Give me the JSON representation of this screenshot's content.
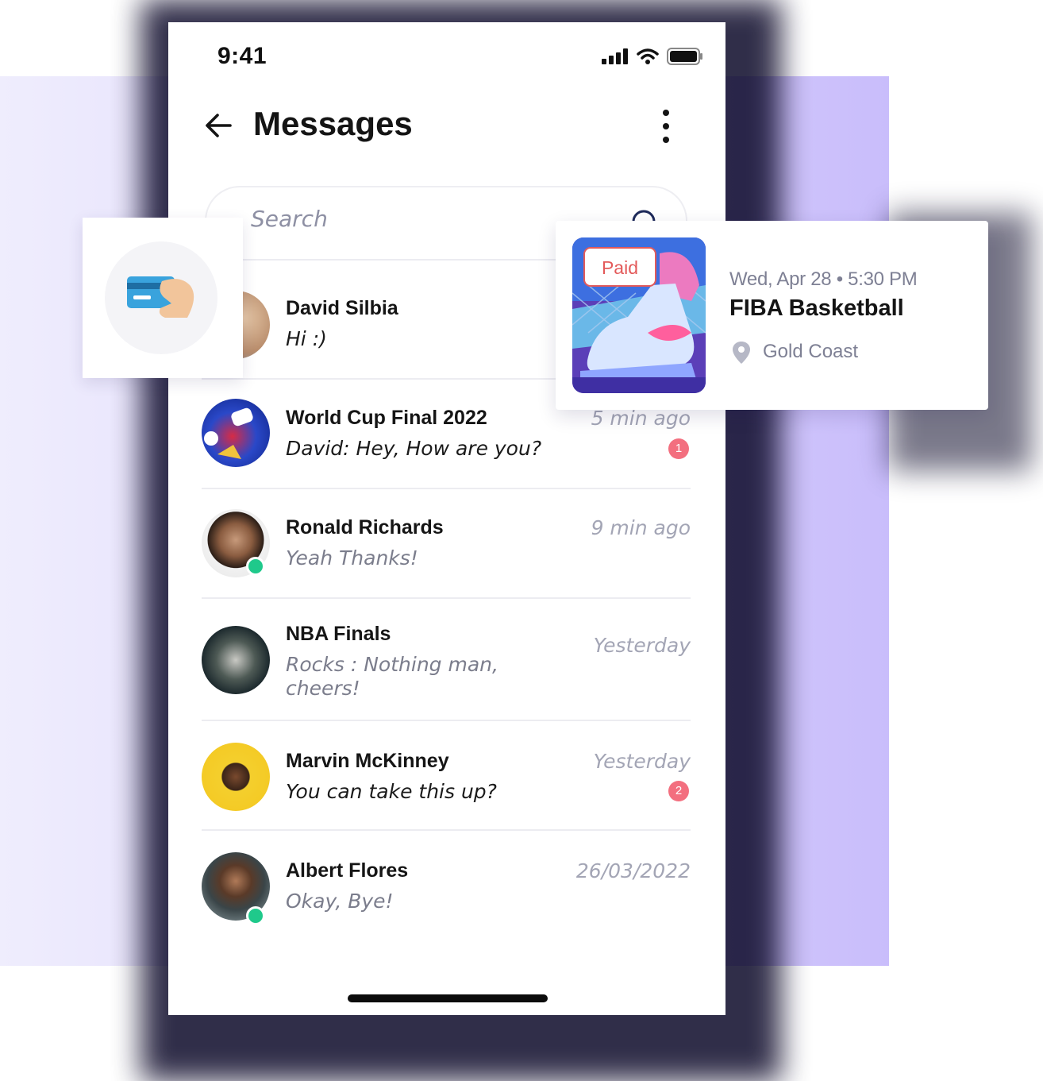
{
  "status_bar": {
    "time": "9:41"
  },
  "header": {
    "title": "Messages"
  },
  "search": {
    "placeholder": "Search"
  },
  "chats": [
    {
      "name": "David  Silbia",
      "preview": "Hi :)",
      "time": "",
      "badge": ""
    },
    {
      "name": "World Cup Final 2022",
      "preview": "David: Hey, How are you?",
      "time": "5 min ago",
      "badge": "1"
    },
    {
      "name": "Ronald Richards",
      "preview": "Yeah Thanks!",
      "time": "9 min ago",
      "badge": ""
    },
    {
      "name": "NBA Finals",
      "preview": "Rocks : Nothing man, cheers!",
      "time": "Yesterday",
      "badge": ""
    },
    {
      "name": "Marvin McKinney",
      "preview": "You can take this up?",
      "time": "Yesterday",
      "badge": "2"
    },
    {
      "name": "Albert Flores",
      "preview": "Okay, Bye!",
      "time": "26/03/2022",
      "badge": ""
    }
  ],
  "event_card": {
    "status": "Paid",
    "datetime": "Wed, Apr 28 • 5:30 PM",
    "title": "FIBA Basketball",
    "location": "Gold Coast"
  },
  "colors": {
    "accent_unread": "#f36f7f",
    "online": "#1fc98b",
    "background_gradient": [
      "#efedfd",
      "#c9bdfb"
    ],
    "paid": "#e35a5a"
  },
  "icons": [
    "back-arrow-icon",
    "more-vertical-icon",
    "search-icon",
    "credit-card-hand-icon",
    "location-pin-icon",
    "signal-icon",
    "wifi-icon",
    "battery-icon"
  ]
}
